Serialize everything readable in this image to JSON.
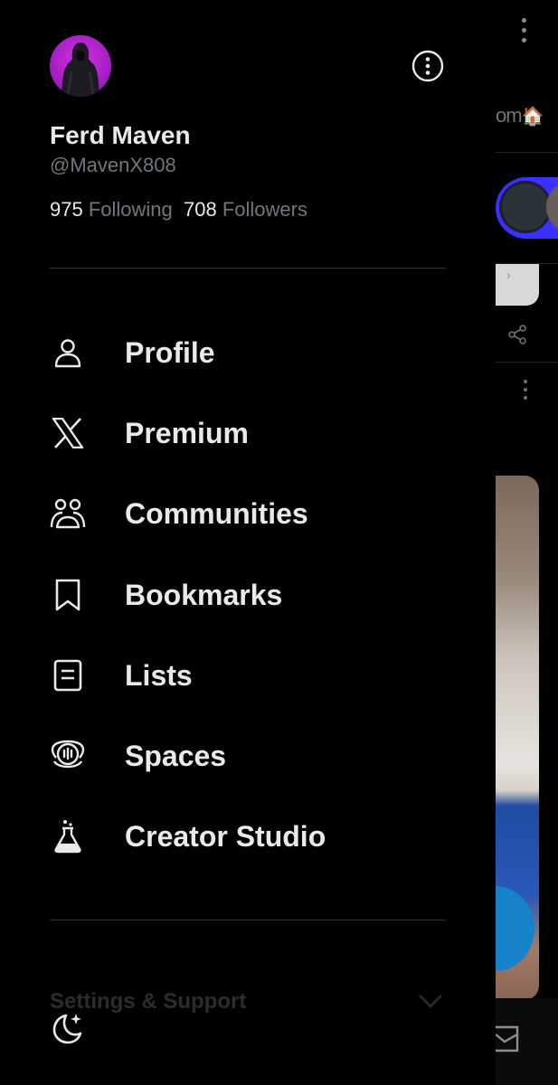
{
  "profile": {
    "name": "Ferd Maven",
    "handle": "@MavenX808",
    "following_count": "975",
    "following_label": "Following",
    "followers_count": "708",
    "followers_label": "Followers"
  },
  "menu": [
    {
      "label": "Profile",
      "icon": "person-icon"
    },
    {
      "label": "Premium",
      "icon": "x-logo-icon"
    },
    {
      "label": "Communities",
      "icon": "communities-icon"
    },
    {
      "label": "Bookmarks",
      "icon": "bookmark-icon"
    },
    {
      "label": "Lists",
      "icon": "list-icon"
    },
    {
      "label": "Spaces",
      "icon": "spaces-icon"
    },
    {
      "label": "Creator Studio",
      "icon": "flask-icon"
    }
  ],
  "settings": {
    "label": "Settings & Support"
  },
  "background": {
    "room_text": "om"
  },
  "colors": {
    "accent": "#1d9bf0",
    "spaces": "#3b31ff",
    "avatar": "#c026d3"
  }
}
